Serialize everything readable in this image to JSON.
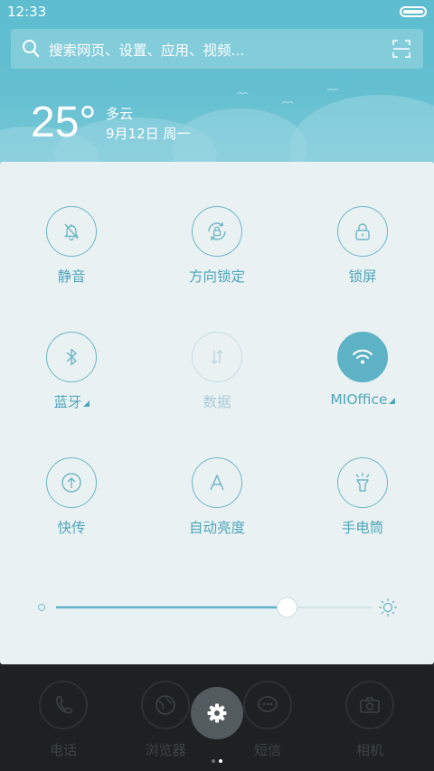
{
  "status_bar": {
    "time": "12:33"
  },
  "search": {
    "placeholder": "搜索网页、设置、应用、视频..."
  },
  "weather": {
    "temperature": "25°",
    "condition": "多云",
    "date": "9月12日 周一"
  },
  "toggles": [
    {
      "label": "静音",
      "icon": "bell-off-icon",
      "state": "off"
    },
    {
      "label": "方向锁定",
      "icon": "rotation-lock-icon",
      "state": "off"
    },
    {
      "label": "锁屏",
      "icon": "lock-icon",
      "state": "off"
    },
    {
      "label": "蓝牙",
      "icon": "bluetooth-icon",
      "state": "off",
      "has_menu": true
    },
    {
      "label": "数据",
      "icon": "mobile-data-icon",
      "state": "disabled"
    },
    {
      "label": "MIOffice",
      "icon": "wifi-icon",
      "state": "on",
      "has_menu": true
    },
    {
      "label": "快传",
      "icon": "share-transfer-icon",
      "state": "off"
    },
    {
      "label": "自动亮度",
      "icon": "auto-brightness-icon",
      "state": "off"
    },
    {
      "label": "手电筒",
      "icon": "flashlight-icon",
      "state": "off"
    }
  ],
  "brightness": {
    "level": 0.73
  },
  "dock": [
    {
      "label": "电话",
      "icon": "phone-icon"
    },
    {
      "label": "浏览器",
      "icon": "browser-icon"
    },
    {
      "label": "短信",
      "icon": "message-icon"
    },
    {
      "label": "相机",
      "icon": "camera-icon"
    }
  ],
  "page_indicator": {
    "pages": 2,
    "current": 2
  },
  "colors": {
    "accent": "#5eb2c6",
    "header": "#63bfd0",
    "panel": "#eaf1f3"
  }
}
